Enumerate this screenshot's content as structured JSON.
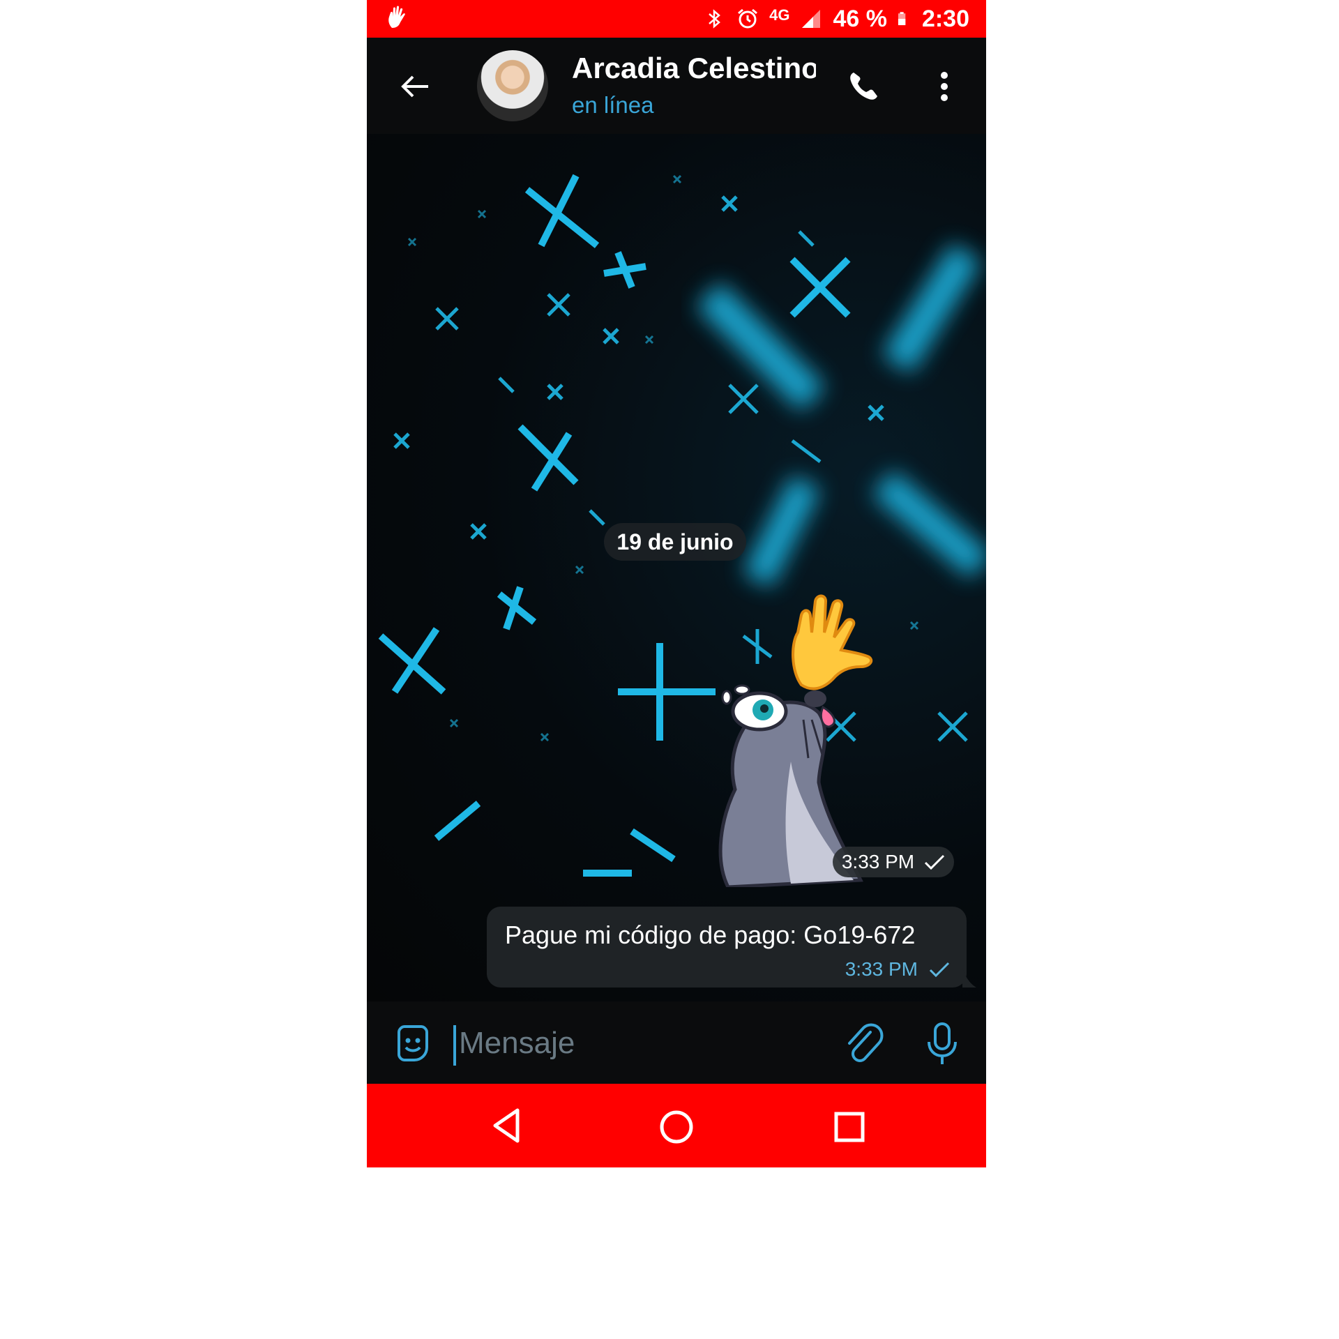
{
  "status_bar": {
    "network": "4G",
    "battery": "46 %",
    "time": "2:30",
    "background_color": "#ff0000",
    "icons": [
      "hand-notification-icon",
      "bluetooth-icon",
      "alarm-icon",
      "signal-icon",
      "battery-icon"
    ]
  },
  "header": {
    "contact_name": "Arcadia Celestino",
    "contact_status": "en línea",
    "icons": [
      "back-arrow-icon",
      "phone-icon",
      "more-vert-icon"
    ]
  },
  "chat": {
    "date_label": "19 de junio",
    "messages": [
      {
        "type": "sticker",
        "time": "3:33 PM",
        "status": "sent",
        "sticker_name": "seal-waving-hand-sticker"
      },
      {
        "type": "text",
        "text": "Pague mi código de pago: Go19-672",
        "time": "3:33 PM",
        "status": "sent"
      }
    ],
    "accent_color": "#3aa6d8"
  },
  "input_bar": {
    "placeholder": "Mensaje",
    "value": "",
    "icons": [
      "sticker-emoji-icon",
      "paperclip-icon",
      "microphone-icon"
    ]
  },
  "nav_bar": {
    "background_color": "#ff0000",
    "icons": [
      "nav-back-icon",
      "nav-home-icon",
      "nav-recents-icon"
    ]
  }
}
